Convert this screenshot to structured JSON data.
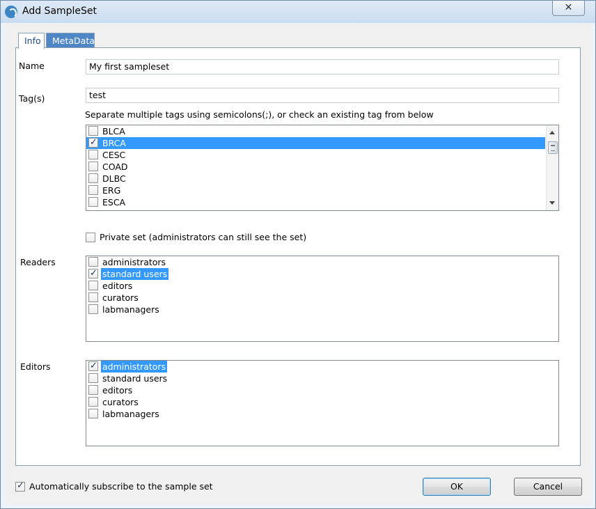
{
  "window": {
    "title": "Add SampleSet",
    "close_glyph": "✕"
  },
  "tabs": [
    {
      "label": "Info",
      "active": true
    },
    {
      "label": "MetaData",
      "active": false
    }
  ],
  "form": {
    "name_label": "Name",
    "name_value": "My first sampleset",
    "tags_label": "Tag(s)",
    "tags_value": "test",
    "tags_hint": "Separate multiple tags using semicolons(;), or check an existing tag from below",
    "tag_list": [
      {
        "label": "BLCA",
        "checked": false,
        "selected": false
      },
      {
        "label": "BRCA",
        "checked": true,
        "selected": true
      },
      {
        "label": "CESC",
        "checked": false,
        "selected": false
      },
      {
        "label": "COAD",
        "checked": false,
        "selected": false
      },
      {
        "label": "DLBC",
        "checked": false,
        "selected": false
      },
      {
        "label": "ERG",
        "checked": false,
        "selected": false
      },
      {
        "label": "ESCA",
        "checked": false,
        "selected": false
      }
    ],
    "private_set_label": "Private set (administrators can still see the set)",
    "private_set_checked": false,
    "readers_label": "Readers",
    "readers": [
      {
        "label": "administrators",
        "checked": false,
        "selected": false
      },
      {
        "label": "standard users",
        "checked": true,
        "selected": true
      },
      {
        "label": "editors",
        "checked": false,
        "selected": false
      },
      {
        "label": "curators",
        "checked": false,
        "selected": false
      },
      {
        "label": "labmanagers",
        "checked": false,
        "selected": false
      }
    ],
    "editors_label": "Editors",
    "editors": [
      {
        "label": "administrators",
        "checked": true,
        "selected": true
      },
      {
        "label": "standard users",
        "checked": false,
        "selected": false
      },
      {
        "label": "editors",
        "checked": false,
        "selected": false
      },
      {
        "label": "curators",
        "checked": false,
        "selected": false
      },
      {
        "label": "labmanagers",
        "checked": false,
        "selected": false
      }
    ]
  },
  "footer": {
    "subscribe_label": "Automatically subscribe to the sample set",
    "subscribe_checked": true,
    "ok_label": "OK",
    "cancel_label": "Cancel"
  },
  "colors": {
    "selection": "#3399ff",
    "active_tab_text": "#1f4b8a",
    "inactive_tab_bg": "#4f86c6"
  },
  "icons": {
    "app": "app-logo-icon",
    "close": "close-icon",
    "check": "checkmark-icon"
  }
}
